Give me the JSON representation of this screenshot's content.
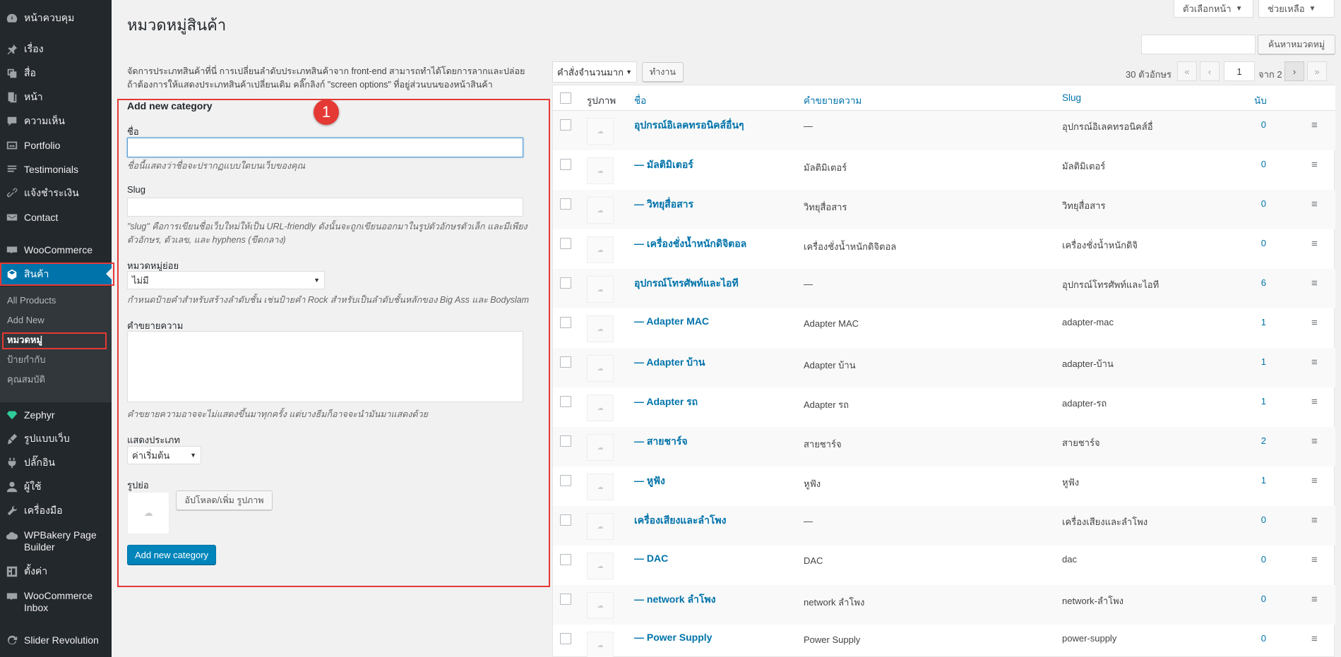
{
  "sidebar": {
    "items": [
      {
        "label": "หน้าควบคุม",
        "icon": "dashboard-icon"
      },
      {
        "label": "เรื่อง",
        "icon": "pin-icon"
      },
      {
        "label": "สื่อ",
        "icon": "media-icon"
      },
      {
        "label": "หน้า",
        "icon": "page-icon"
      },
      {
        "label": "ความเห็น",
        "icon": "comment-icon"
      },
      {
        "label": "Portfolio",
        "icon": "portfolio-icon"
      },
      {
        "label": "Testimonials",
        "icon": "testimonial-icon"
      },
      {
        "label": "แจ้งชำระเงิน",
        "icon": "link-icon"
      },
      {
        "label": "Contact",
        "icon": "mail-icon"
      },
      {
        "label": "WooCommerce",
        "icon": "woo-icon"
      },
      {
        "label": "สินค้า",
        "icon": "product-icon"
      },
      {
        "label": "Zephyr",
        "icon": "diamond-icon"
      },
      {
        "label": "รูปแบบเว็บ",
        "icon": "brush-icon"
      },
      {
        "label": "ปลั๊กอิน",
        "icon": "plugin-icon"
      },
      {
        "label": "ผู้ใช้",
        "icon": "user-icon"
      },
      {
        "label": "เครื่องมือ",
        "icon": "wrench-icon"
      },
      {
        "label": "WPBakery Page Builder",
        "icon": "cloud-icon"
      },
      {
        "label": "ตั้งค่า",
        "icon": "settings-icon"
      },
      {
        "label": "WooCommerce Inbox",
        "icon": "inbox-icon"
      },
      {
        "label": "Slider Revolution",
        "icon": "refresh-icon"
      }
    ],
    "submenu": [
      "All Products",
      "Add New",
      "หมวดหมู่",
      "ป้ายกำกับ",
      "คุณสมบัติ"
    ]
  },
  "header": {
    "title": "หมวดหมู่สินค้า",
    "screen_options": "ตัวเลือกหน้า",
    "help": "ช่วยเหลือ",
    "search_button": "ค้นหาหมวดหมู่"
  },
  "form": {
    "description": "จัดการประเภทสินค้าที่นี่ การเปลี่ยนลำดับประเภทสินค้าจาก front-end สามารถทำได้โดยการลากและปล่อย ถ้าต้องการให้แสดงประเภทสินค้าเปลี่ยนเดิม คลิ๊กลิงก์ \"screen options\" ที่อยู่ส่วนบนของหน้าสินค้า",
    "title": "Add new category",
    "annotation_number": "1",
    "name_label": "ชื่อ",
    "name_hint": "ชื่อนี้แสดงว่าชื่อจะปรากฏแบบใดบนเว็บของคุณ",
    "slug_label": "Slug",
    "slug_hint": "\"slug\" คือการเขียนชื่อเว็บใหม่ให้เป็น URL-friendly ดังนั้นจะถูกเขียนออกมาในรูปตัวอักษรตัวเล็ก และมีเพียงตัวอักษร, ตัวเลข, และ hyphens (ขีดกลาง)",
    "parent_label": "หมวดหมู่ย่อย",
    "parent_value": "ไม่มี",
    "parent_hint": "กำหนดป้ายคำสำหรับสร้างลำดับชั้น เช่นป้ายคำ Rock สำหรับเป็นลำดับชั้นหลักของ Big Ass และ Bodyslam",
    "desc_label": "คำขยายความ",
    "desc_hint": "คำขยายความอาจจะไม่แสดงขึ้นมาทุกครั้ง แต่บางธีมก็อาจจะนำมันมาแสดงด้วย",
    "display_label": "แสดงประเภท",
    "display_value": "ค่าเริ่มต้น",
    "thumb_label": "รูปย่อ",
    "upload_button": "อัปโหลด/เพิ่ม รูปภาพ",
    "submit_button": "Add new category"
  },
  "tablenav": {
    "bulk_action": "คำสั่งจำนวนมาก",
    "apply": "ทำงาน",
    "count": "30 ตัวอักษร",
    "first": "«",
    "prev": "‹",
    "page": "1",
    "of": "จาก 2",
    "next": "›",
    "last": "»"
  },
  "table": {
    "columns": {
      "image": "รูปภาพ",
      "name": "ชื่อ",
      "description": "คำขยายความ",
      "slug": "Slug",
      "count": "นับ"
    },
    "rows": [
      {
        "name": "อุปกรณ์อิเลคทรอนิคส์อื่นๆ",
        "description": "—",
        "slug": "อุปกรณ์อิเลคทรอนิคส์อื่",
        "count": "0"
      },
      {
        "name": "— มัลติมิเตอร์",
        "description": "มัลติมิเตอร์",
        "slug": "มัลติมิเตอร์",
        "count": "0"
      },
      {
        "name": "— วิทยุสื่อสาร",
        "description": "วิทยุสื่อสาร",
        "slug": "วิทยุสื่อสาร",
        "count": "0"
      },
      {
        "name": "— เครื่องชั่งน้ำหนักดิจิตอล",
        "description": "เครื่องชั่งน้ำหนักดิจิตอล",
        "slug": "เครื่องชั่งน้ำหนักดิจิ",
        "count": "0"
      },
      {
        "name": "อุปกรณ์โทรศัพท์และไอที",
        "description": "—",
        "slug": "อุปกรณ์โทรศัพท์และไอที",
        "count": "6"
      },
      {
        "name": "— Adapter MAC",
        "description": "Adapter MAC",
        "slug": "adapter-mac",
        "count": "1"
      },
      {
        "name": "— Adapter บ้าน",
        "description": "Adapter บ้าน",
        "slug": "adapter-บ้าน",
        "count": "1"
      },
      {
        "name": "— Adapter รถ",
        "description": "Adapter รถ",
        "slug": "adapter-รถ",
        "count": "1"
      },
      {
        "name": "— สายชาร์จ",
        "description": "สายชาร์จ",
        "slug": "สายชาร์จ",
        "count": "2"
      },
      {
        "name": "— หูฟัง",
        "description": "หูฟัง",
        "slug": "หูฟัง",
        "count": "1"
      },
      {
        "name": "เครื่องเสียงและลำโพง",
        "description": "—",
        "slug": "เครื่องเสียงและลำโพง",
        "count": "0"
      },
      {
        "name": "— DAC",
        "description": "DAC",
        "slug": "dac",
        "count": "0"
      },
      {
        "name": "— network ลำโพง",
        "description": "network ลำโพง",
        "slug": "network-ลำโพง",
        "count": "0"
      },
      {
        "name": "— Power Supply",
        "description": "Power Supply",
        "slug": "power-supply",
        "count": "0"
      }
    ]
  },
  "colors": {
    "sidebar": "#23282d",
    "accent": "#0073aa",
    "highlight": "#e53935"
  }
}
